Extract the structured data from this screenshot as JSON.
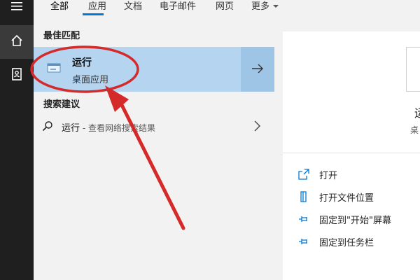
{
  "tabs": [
    "全部",
    "应用",
    "文档",
    "电子邮件",
    "网页",
    "更多"
  ],
  "rail": {
    "icons": [
      "hamburger-menu-icon",
      "home-icon",
      "notebook-icon"
    ]
  },
  "left": {
    "best_match_heading": "最佳匹配",
    "best_match": {
      "title": "运行",
      "subtitle": "桌面应用"
    },
    "suggestions_heading": "搜索建议",
    "suggestion": {
      "text": "运行",
      "suffix": " - 查看网络搜索结果"
    }
  },
  "preview": {
    "title": "运",
    "subtitle": "桌"
  },
  "actions": [
    {
      "label": "打开",
      "icon": "open-icon"
    },
    {
      "label": "打开文件位置",
      "icon": "file-location-icon"
    },
    {
      "label": "固定到\"开始\"屏幕",
      "icon": "pin-icon"
    },
    {
      "label": "固定到任务栏",
      "icon": "pin-icon"
    }
  ],
  "colors": {
    "accent": "#0078d7",
    "selection": "#b4d4f0",
    "annotation": "#d42a2a"
  }
}
